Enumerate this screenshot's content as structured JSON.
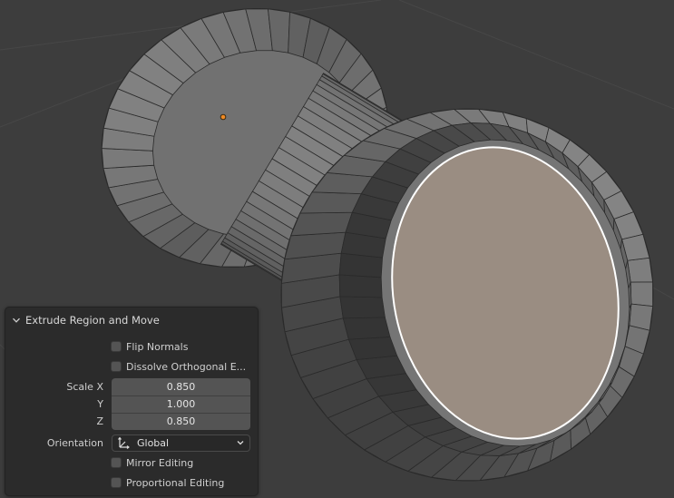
{
  "viewport": {
    "background": "#3d3d3d",
    "mesh_color": "#7b7b7b",
    "selected_face_color": "#9a8d82",
    "selected_edge_color": "#ffffff",
    "origin_color": "#f08a24"
  },
  "operator_panel": {
    "title": "Extrude Region and Move",
    "flip_normals_label": "Flip Normals",
    "flip_normals_checked": false,
    "dissolve_label": "Dissolve Orthogonal E...",
    "dissolve_checked": false,
    "scale_x_label": "Scale X",
    "scale_x_value": "0.850",
    "scale_y_label": "Y",
    "scale_y_value": "1.000",
    "scale_z_label": "Z",
    "scale_z_value": "0.850",
    "orientation_label": "Orientation",
    "orientation_value": "Global",
    "mirror_label": "Mirror Editing",
    "mirror_checked": false,
    "proportional_label": "Proportional Editing",
    "proportional_checked": false
  }
}
